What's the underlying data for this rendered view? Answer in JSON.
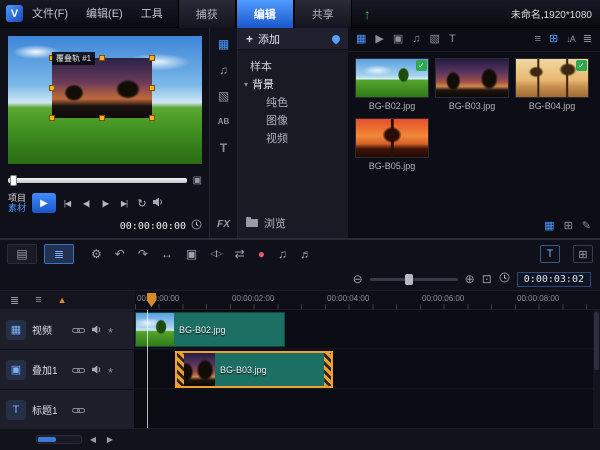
{
  "titlebar": {
    "menus": [
      {
        "label": "文件(F)"
      },
      {
        "label": "编辑(E)"
      },
      {
        "label": "工具"
      }
    ],
    "tabs": [
      {
        "label": "捕获"
      },
      {
        "label": "编辑"
      },
      {
        "label": "共享"
      }
    ],
    "project_info": "未命名,1920*1080"
  },
  "preview": {
    "overlay_label": "覆叠轨 #1",
    "mode_project": "项目",
    "mode_clip": "素材",
    "timecode": "00:00:00:00"
  },
  "library": {
    "add_label": "添加",
    "browse_label": "浏览",
    "tree": {
      "root": "样本",
      "group": "背景",
      "children": [
        {
          "label": "纯色"
        },
        {
          "label": "图像"
        },
        {
          "label": "视频"
        }
      ]
    },
    "items": [
      {
        "name": "BG-B02.jpg",
        "checked": true
      },
      {
        "name": "BG-B03.jpg",
        "checked": false
      },
      {
        "name": "BG-B04.jpg",
        "checked": true
      },
      {
        "name": "BG-B05.jpg",
        "checked": false
      }
    ]
  },
  "timeline": {
    "selected_duration": "0:00:03:02",
    "ruler": [
      {
        "label": "00:00:00:00"
      },
      {
        "label": "00:00:02:00"
      },
      {
        "label": "00:00:04:00"
      },
      {
        "label": "00:00:06:00"
      },
      {
        "label": "00:00:08:00"
      }
    ],
    "tracks": [
      {
        "label": "视频",
        "clip": {
          "name": "BG-B02.jpg"
        }
      },
      {
        "label": "叠加1",
        "clip": {
          "name": "BG-B03.jpg"
        }
      },
      {
        "label": "标题1"
      }
    ]
  },
  "colors": {
    "accent": "#2f7fe8",
    "selection": "#f0a030",
    "clip": "#1c6f63",
    "check": "#2fa84f"
  },
  "icons": {
    "logo": "V",
    "publish": "↑",
    "check": "✓",
    "add": "+",
    "tree_expand": "▾",
    "play": "▶",
    "home": "|◀",
    "prev_frame": "◀|",
    "next_frame": "|▶",
    "end_frame": "▶|",
    "repeat": "↻",
    "dual_view": "▣",
    "lib_media": "▦",
    "lib_audio": "♫",
    "lib_transition": "▧",
    "lib_title_ab": "AB",
    "lib_text": "T",
    "lib_fx": "FX",
    "gal_media": "▦",
    "gal_video": "▶",
    "gal_photo": "▣",
    "gal_audio": "♫",
    "gal_transition": "▧",
    "gal_title": "T",
    "gal_list": "≡",
    "gal_grid": "⊞",
    "gal_sort": "↓A",
    "gal_options": "≣",
    "gal_import": "▦",
    "gal_view": "⊞",
    "gal_edit": "✎",
    "storyboard": "▤",
    "timeline_view": "≣",
    "tools": "⚙",
    "undo": "↶",
    "redo": "↷",
    "fit": "↔",
    "record_box": "▣",
    "split": "◁|▷",
    "ripple": "⇄",
    "mixer": "●",
    "sound_mixer": "♫",
    "auto_music": "♬",
    "subtitle": "T",
    "grid_view": "⊞",
    "zoom_out": "⊖",
    "zoom_in": "⊕",
    "fit_window": "⊡",
    "track_manager": "≣",
    "ruler_options": "≡",
    "scroll_up": "▲",
    "track_video": "▦",
    "track_overlay": "▣",
    "track_title": "T",
    "ripple_edit": "*",
    "scroll_left": "◀",
    "scroll_right": "▶"
  }
}
